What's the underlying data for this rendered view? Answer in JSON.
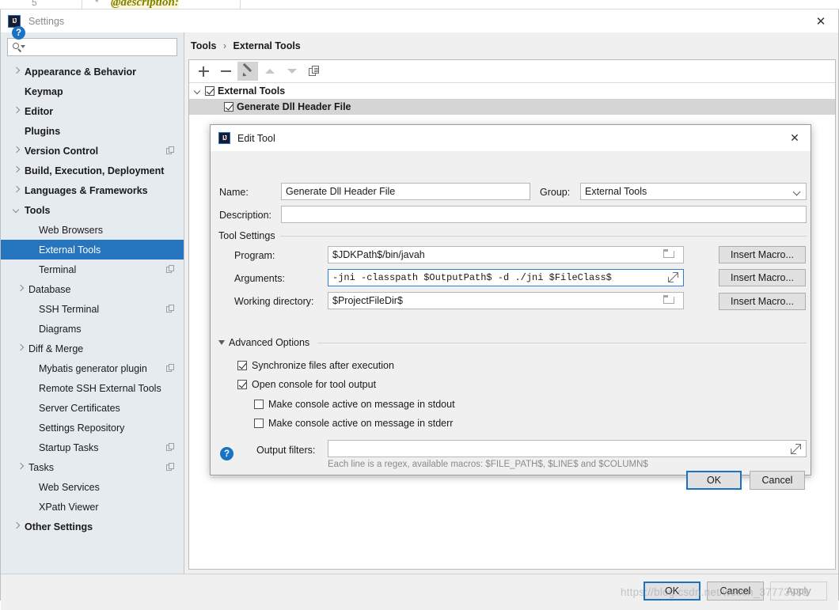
{
  "background": {
    "code_line_number": "5",
    "code_marker": "*",
    "code_text": "@description:"
  },
  "settings_window": {
    "title": "Settings",
    "app_icon": "intellij-idea-icon",
    "close_icon": "close-icon",
    "help_icon": "help-icon",
    "search": {
      "value": "",
      "placeholder": "",
      "icon": "search-icon"
    },
    "sidebar": [
      {
        "label": "Appearance & Behavior",
        "arrow": "right",
        "bold": true,
        "indent": 0,
        "badge": false,
        "selected": false
      },
      {
        "label": "Keymap",
        "arrow": "none",
        "bold": true,
        "indent": 0,
        "badge": false,
        "selected": false
      },
      {
        "label": "Editor",
        "arrow": "right",
        "bold": true,
        "indent": 0,
        "badge": false,
        "selected": false
      },
      {
        "label": "Plugins",
        "arrow": "none",
        "bold": true,
        "indent": 0,
        "badge": false,
        "selected": false
      },
      {
        "label": "Version Control",
        "arrow": "right",
        "bold": true,
        "indent": 0,
        "badge": true,
        "selected": false
      },
      {
        "label": "Build, Execution, Deployment",
        "arrow": "right",
        "bold": true,
        "indent": 0,
        "badge": false,
        "selected": false
      },
      {
        "label": "Languages & Frameworks",
        "arrow": "right",
        "bold": true,
        "indent": 0,
        "badge": false,
        "selected": false
      },
      {
        "label": "Tools",
        "arrow": "down",
        "bold": true,
        "indent": 0,
        "badge": false,
        "selected": false
      },
      {
        "label": "Web Browsers",
        "arrow": "none",
        "bold": false,
        "indent": 1,
        "badge": false,
        "selected": false
      },
      {
        "label": "External Tools",
        "arrow": "none",
        "bold": false,
        "indent": 1,
        "badge": false,
        "selected": true
      },
      {
        "label": "Terminal",
        "arrow": "none",
        "bold": false,
        "indent": 1,
        "badge": true,
        "selected": false
      },
      {
        "label": "Database",
        "arrow": "right",
        "bold": false,
        "indent": 1,
        "badge": false,
        "selected": false
      },
      {
        "label": "SSH Terminal",
        "arrow": "none",
        "bold": false,
        "indent": 1,
        "badge": true,
        "selected": false
      },
      {
        "label": "Diagrams",
        "arrow": "none",
        "bold": false,
        "indent": 1,
        "badge": false,
        "selected": false
      },
      {
        "label": "Diff & Merge",
        "arrow": "right",
        "bold": false,
        "indent": 1,
        "badge": false,
        "selected": false
      },
      {
        "label": "Mybatis generator plugin",
        "arrow": "none",
        "bold": false,
        "indent": 1,
        "badge": true,
        "selected": false
      },
      {
        "label": "Remote SSH External Tools",
        "arrow": "none",
        "bold": false,
        "indent": 1,
        "badge": false,
        "selected": false
      },
      {
        "label": "Server Certificates",
        "arrow": "none",
        "bold": false,
        "indent": 1,
        "badge": false,
        "selected": false
      },
      {
        "label": "Settings Repository",
        "arrow": "none",
        "bold": false,
        "indent": 1,
        "badge": false,
        "selected": false
      },
      {
        "label": "Startup Tasks",
        "arrow": "none",
        "bold": false,
        "indent": 1,
        "badge": true,
        "selected": false
      },
      {
        "label": "Tasks",
        "arrow": "right",
        "bold": false,
        "indent": 1,
        "badge": true,
        "selected": false
      },
      {
        "label": "Web Services",
        "arrow": "none",
        "bold": false,
        "indent": 1,
        "badge": false,
        "selected": false
      },
      {
        "label": "XPath Viewer",
        "arrow": "none",
        "bold": false,
        "indent": 1,
        "badge": false,
        "selected": false
      },
      {
        "label": "Other Settings",
        "arrow": "right",
        "bold": true,
        "indent": 0,
        "badge": false,
        "selected": false
      }
    ],
    "breadcrumb": {
      "root": "Tools",
      "separator": "›",
      "current": "External Tools"
    },
    "toolbar": [
      {
        "name": "add-tool-button",
        "icon": "plus-icon",
        "state": "enabled"
      },
      {
        "name": "remove-tool-button",
        "icon": "minus-icon",
        "state": "enabled"
      },
      {
        "name": "edit-tool-button",
        "icon": "pencil-icon",
        "state": "active"
      },
      {
        "name": "move-up-button",
        "icon": "arrow-up-icon",
        "state": "disabled"
      },
      {
        "name": "move-down-button",
        "icon": "arrow-down-icon",
        "state": "disabled"
      },
      {
        "name": "copy-tool-button",
        "icon": "copy-icon",
        "state": "enabled"
      }
    ],
    "tools_tree": [
      {
        "label": "External Tools",
        "checked": true,
        "group": true,
        "selected": false
      },
      {
        "label": "Generate Dll Header File",
        "checked": true,
        "group": false,
        "selected": true
      }
    ],
    "buttons": {
      "ok": "OK",
      "cancel": "Cancel",
      "apply": "Apply"
    }
  },
  "edit_dialog": {
    "title": "Edit Tool",
    "app_icon": "intellij-idea-icon",
    "close_icon": "close-icon",
    "help_icon": "help-icon",
    "name": {
      "label": "Name:",
      "value": "Generate Dll Header File"
    },
    "group": {
      "label": "Group:",
      "value": "External Tools",
      "chevron_icon": "chevron-down-icon"
    },
    "description": {
      "label": "Description:",
      "value": ""
    },
    "tool_settings": {
      "legend": "Tool Settings",
      "program": {
        "label": "Program:",
        "value": "$JDKPath$/bin/javah",
        "browse_icon": "folder-icon",
        "macro_button": "Insert Macro..."
      },
      "arguments": {
        "label": "Arguments:",
        "value": "-jni -classpath $OutputPath$ -d ./jni $FileClass$",
        "expand_icon": "expand-icon",
        "macro_button": "Insert Macro..."
      },
      "working_directory": {
        "label": "Working directory:",
        "value": "$ProjectFileDir$",
        "browse_icon": "folder-icon",
        "macro_button": "Insert Macro..."
      }
    },
    "advanced_options": {
      "legend": "Advanced Options",
      "toggle_icon": "triangle-down-icon",
      "checkboxes": [
        {
          "label": "Synchronize files after execution",
          "checked": true
        },
        {
          "label": "Open console for tool output",
          "checked": true
        },
        {
          "label": "Make console active on message in stdout",
          "checked": false
        },
        {
          "label": "Make console active on message in stderr",
          "checked": false
        }
      ],
      "output_filters": {
        "label": "Output filters:",
        "value": "",
        "expand_icon": "expand-icon"
      },
      "hint": "Each line is a regex, available macros: $FILE_PATH$, $LINE$ and $COLUMN$"
    },
    "buttons": {
      "ok": "OK",
      "cancel": "Cancel"
    }
  },
  "watermark": {
    "text": "https://blog.csdn.net/weixin_37773933"
  },
  "colors": {
    "accent": "#2675bf",
    "selection": "#2675bf",
    "dialog_bg": "#f0f0f0",
    "sidebar_bg": "#e6ebef",
    "focus_border": "#2d7dd2"
  }
}
